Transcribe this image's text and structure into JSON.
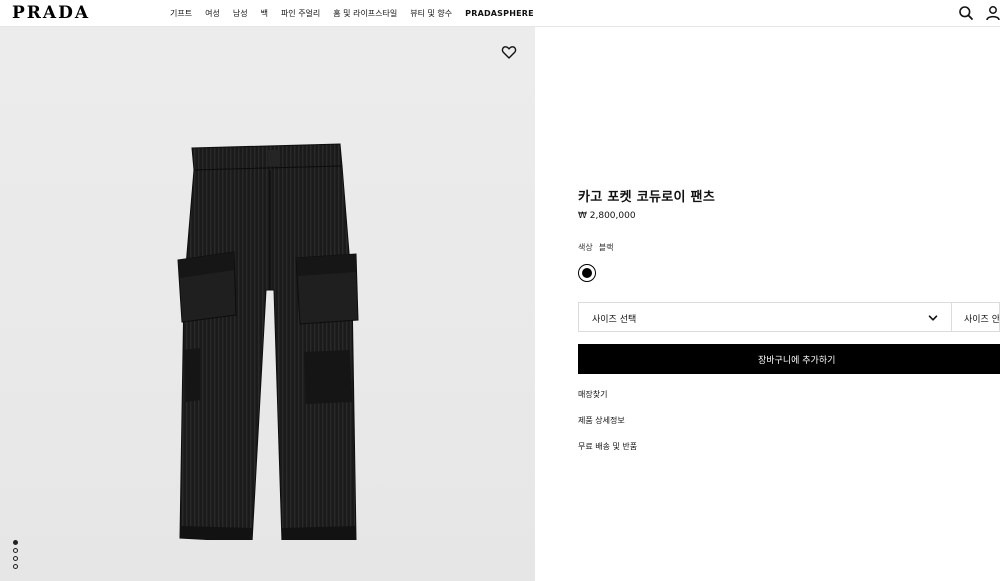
{
  "header": {
    "logo": "PRADA",
    "nav": [
      "기프트",
      "여성",
      "남성",
      "백",
      "파인 주얼리",
      "홈 및 라이프스타일",
      "뷰티 및 향수",
      "PRADASPHERE"
    ],
    "icons": [
      "search-icon",
      "user-icon"
    ]
  },
  "gallery": {
    "wishlist_icon": "heart-icon",
    "dots_count": 4,
    "active_dot": 1
  },
  "product": {
    "title": "카고 포켓 코듀로이 팬츠",
    "price": "₩ 2,800,000",
    "color_label": "색상",
    "color_value": "블랙",
    "swatch_color": "#000000",
    "size_select_label": "사이즈 선택",
    "size_guide_label": "사이즈 안",
    "add_to_cart_label": "장바구니에 추가하기",
    "links": [
      "매장찾기",
      "제품 상세정보",
      "무료 배송 및 반품"
    ]
  }
}
